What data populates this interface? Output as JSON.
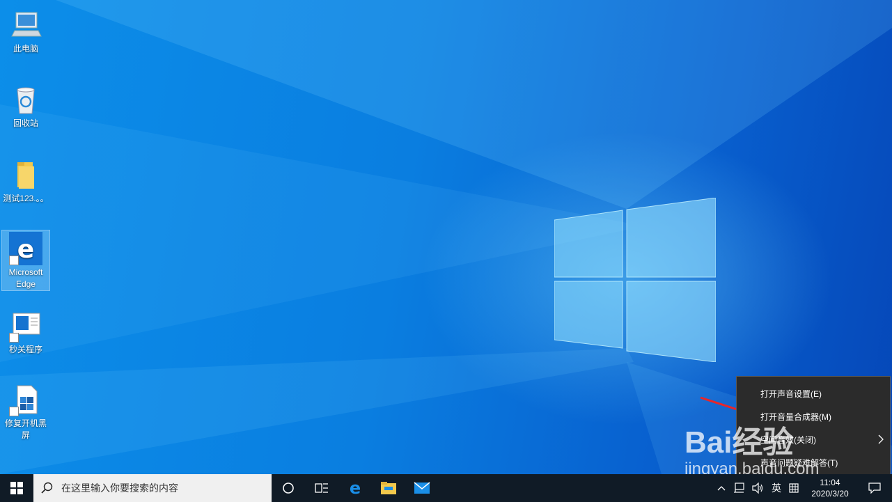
{
  "desktop": {
    "icons": [
      {
        "label": "此电脑",
        "icon": "computer-icon"
      },
      {
        "label": "回收站",
        "icon": "recycle-bin-icon"
      },
      {
        "label": "测试123.。。",
        "icon": "folder-icon"
      },
      {
        "label": "Microsoft Edge",
        "icon": "edge-icon",
        "selected": true
      },
      {
        "label": "秒关程序",
        "icon": "program-shortcut-icon"
      },
      {
        "label": "修复开机黑屏",
        "icon": "repair-tool-icon"
      }
    ]
  },
  "taskbar": {
    "search_placeholder": "在这里输入你要搜索的内容",
    "pinned_apps": [
      "cortana-icon",
      "task-view-icon",
      "edge-icon",
      "file-explorer-icon",
      "mail-icon"
    ],
    "tray": {
      "language": "英",
      "time": "11:04",
      "date": "2020/3/20"
    }
  },
  "context_menu": {
    "items": [
      {
        "label": "打开声音设置(E)"
      },
      {
        "label": "打开音量合成器(M)"
      },
      {
        "label": "空间音效(关闭)",
        "has_submenu": true
      },
      {
        "label": "声音问题疑难解答(T)"
      }
    ]
  },
  "watermark": {
    "brand": "Bai经验",
    "url": "jingyan.baidu.com"
  },
  "colors": {
    "accent": "#0a74d6",
    "taskbar": "#101b26",
    "menu": "#2b2b2b",
    "arrow": "#e8262a"
  }
}
